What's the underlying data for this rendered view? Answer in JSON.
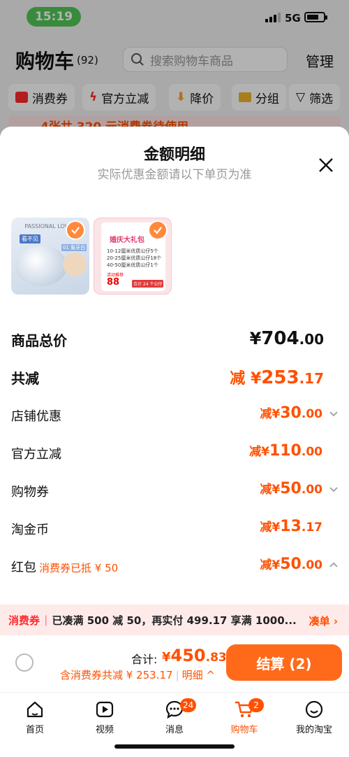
{
  "status": {
    "time": "15:19",
    "network": "5G"
  },
  "cart": {
    "title": "购物车",
    "count": "(92)",
    "search_placeholder": "搜索购物车商品",
    "manage": "管理",
    "chips": [
      "消费券",
      "官方立减",
      "降价",
      "分组",
      "筛选"
    ],
    "strip_text": "4张共 320 元消费券待使用"
  },
  "sheet": {
    "title": "金额明细",
    "subtitle": "实际优惠金额请以下单页为准",
    "thumb2": {
      "title": "婚庆大礼包",
      "lines": [
        "10-12厘米优质公仔5个",
        "20-25厘米优质公仔18个",
        "40-50厘米优质公仔1个"
      ],
      "price_label": "活动推荐",
      "price": "88",
      "tag": "合计 24 个公仔"
    },
    "thumb1": {
      "brand": "PASSIONAL LOVER",
      "tag1": "看不见",
      "tag2": "01 象牙白"
    },
    "rows": [
      {
        "label": "商品总价",
        "prefix": "",
        "currency": "¥",
        "int": "704",
        "dec": ".00",
        "chevron": "",
        "note": ""
      },
      {
        "label": "共减",
        "prefix": "减 ",
        "currency": "¥",
        "int": "253",
        "dec": ".17",
        "chevron": "",
        "note": ""
      },
      {
        "label": "店铺优惠",
        "prefix": "减",
        "currency": "¥",
        "int": "30",
        "dec": ".00",
        "chevron": "down",
        "note": ""
      },
      {
        "label": "官方立减",
        "prefix": "减",
        "currency": "¥",
        "int": "110",
        "dec": ".00",
        "chevron": "",
        "note": ""
      },
      {
        "label": "购物券",
        "prefix": "减",
        "currency": "¥",
        "int": "50",
        "dec": ".00",
        "chevron": "down",
        "note": ""
      },
      {
        "label": "淘金币",
        "prefix": "减",
        "currency": "¥",
        "int": "13",
        "dec": ".17",
        "chevron": "",
        "note": ""
      },
      {
        "label": "红包",
        "prefix": "减",
        "currency": "¥",
        "int": "50",
        "dec": ".00",
        "chevron": "up",
        "note": "消费券已抵 ¥ 50"
      }
    ]
  },
  "promo": {
    "tag": "消费券",
    "text": "已凑满 500 减 50，再实付 499.17 享满 1000...",
    "action": "凑单 ›"
  },
  "checkout": {
    "total_label": "合计:",
    "total_currency": "¥",
    "total_int": "450",
    "total_dec": ".83",
    "sub": "含消费券共减 ¥ 253.17",
    "detail": "明细",
    "pay": "结算 (2)"
  },
  "tabs": [
    {
      "label": "首页",
      "icon": "home-icon"
    },
    {
      "label": "视频",
      "icon": "video-icon"
    },
    {
      "label": "消息",
      "icon": "message-icon",
      "badge": "24"
    },
    {
      "label": "购物车",
      "icon": "cart-icon",
      "badge": "2",
      "active": true
    },
    {
      "label": "我的淘宝",
      "icon": "profile-icon"
    }
  ],
  "colors": {
    "accent": "#ff5000",
    "pay_button": "#ff6a1a",
    "check": "#ff8a3d"
  }
}
